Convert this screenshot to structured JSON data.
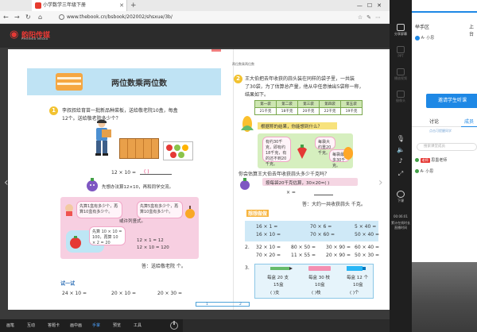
{
  "browser": {
    "tab_title": "小学数学三年级下册",
    "url": "www.thebook.cn/bsbook/202002/shsxue/3b/"
  },
  "viewer": {
    "logo_text": "韵阳传媒",
    "logo_sub": "PHOENIX MEDIA",
    "header_title": "两位数乘两位数",
    "toolbar": [
      "画笔",
      "互动",
      "答题卡",
      "画中画",
      "手掌",
      "预览",
      "工具"
    ],
    "active_tool": "手掌",
    "page_nav": {
      "left": "1",
      "right": "2"
    }
  },
  "left_page": {
    "title": "两位数乘两位数",
    "q1_number": "1",
    "q1_text_1": "李叔叔给育苗一批新品种菜板，送给敬老院10盒，每盒",
    "q1_text_2": "12个。送给敬老院多少个？",
    "eq1": "12 × 10 =",
    "eq1_bracket": "(        )",
    "hint_bubble": "先想办法算12×10，再和同学交流。",
    "bubble1": "先算1盒有多少个，再算10盒有多少个。",
    "bubble2": "先算5盒有多少个，再算10盒有多少个。",
    "bubble3": "先算 10 × 10 = 100，再算 10 × 2 = 20",
    "bubble4": "或许列竖式。",
    "eq_a": "12 × 1 = 12",
    "eq_b": "12 × 10 = 120",
    "answer_text": "答：送给敬老院          个。",
    "try_title": "试一试",
    "try_1": "24 × 10 =",
    "try_2": "20 × 10 =",
    "try_3": "20 × 30 =",
    "page_number": "1"
  },
  "right_page": {
    "header": "两位数乘两位数",
    "q2_number": "2",
    "q2_text_1": "王大伯把去年收获的蒜头装在同样的袋子里，一共装",
    "q2_text_2": "了30袋，为了估算总产量，他从中任意抽出5袋称一称，",
    "q2_text_3": "结果如下。",
    "table_head": [
      "第一袋",
      "第二袋",
      "第三袋",
      "第四袋",
      "第五袋"
    ],
    "table_vals": [
      "21千克",
      "18千克",
      "20千克",
      "22千克",
      "19千克"
    ],
    "hl_text": "根据称的结果，你能想到什么？",
    "green_left": "有约30千克，即有约18千克，有的还不到20千克。",
    "green_right": "每袋大约重20千克。",
    "green_right2": "每袋最多30千克。",
    "q_estimate": "你会估算王大伯去年收获蒜头多少千克吗？",
    "hl2": "按每袋20千克估算，30×20=(        )",
    "line_eq": "   ×        =",
    "answer2": "答：大约一共收获蒜头      千克。",
    "practice_title": "想想做做",
    "p1": [
      "16 × 1 =",
      "70 × 6 =",
      "5 × 40 ="
    ],
    "p1b": [
      "16 × 10 =",
      "70 × 60 =",
      "50 × 40 ="
    ],
    "p2_num": "2.",
    "p2": [
      "32 × 10 =",
      "80 × 50 =",
      "30 × 90 =",
      "60 × 40 ="
    ],
    "p2b": [
      "70 × 20 =",
      "11 × 55 =",
      "20 × 90 =",
      "50 × 30 ="
    ],
    "p3_num": "3.",
    "p3_head": [
      "每盒 20 支",
      "每盒 30 枝",
      "每盒 12 个"
    ],
    "p3_mid": [
      "15盒",
      "10盒",
      "10盒"
    ],
    "p3_unit": [
      "(      )支",
      "(      )枝",
      "(      )个"
    ],
    "page_number": "2"
  },
  "side_strip": {
    "items": [
      "分享屏幕",
      "PPT",
      "播放视频",
      "摄像头"
    ],
    "mic": "麦",
    "down_label": "下课",
    "timer": "00:06:01",
    "timer_sub": "累计在线时长",
    "timer_sub2": "直播时间"
  },
  "panel": {
    "room": "举手区",
    "room_right": "上台",
    "user": "A- 小思",
    "invite": "邀请学生听课",
    "tab_discuss": "讨论",
    "tab_members": "成员",
    "hint": "点击可提醒同学",
    "search_placeholder": "搜索课堂成员",
    "chat": [
      {
        "badge": "老师",
        "name": "思墨老师"
      },
      {
        "badge": "",
        "name": "A- 小思"
      }
    ]
  },
  "colors": {
    "accent": "#1e88e5",
    "logo": "#e53935",
    "title_band": "#bfe3f4",
    "pink": "#f7cfe1",
    "green": "#d6efbf"
  }
}
